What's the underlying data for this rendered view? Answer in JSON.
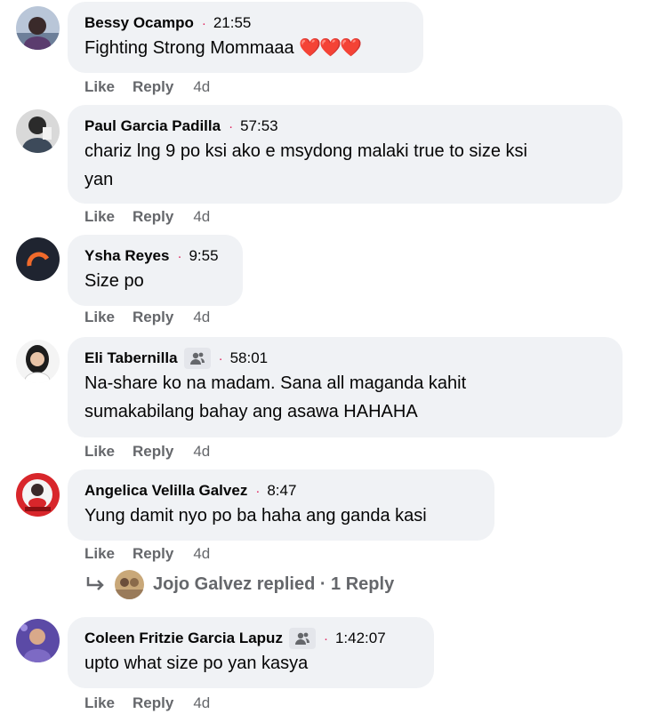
{
  "comments": [
    {
      "author": "Bessy Ocampo",
      "time": "21:55",
      "text": "Fighting Strong Mommaaa",
      "emoji": "❤️❤️❤️",
      "like": "Like",
      "reply": "Reply",
      "age": "4d"
    },
    {
      "author": "Paul Garcia Padilla",
      "time": "57:53",
      "text_line1": "chariz lng 9 po ksi ako e msydong malaki true to size ksi",
      "text_line2": "yan",
      "like": "Like",
      "reply": "Reply",
      "age": "4d"
    },
    {
      "author": "Ysha Reyes",
      "time": "9:55",
      "text": "Size po",
      "like": "Like",
      "reply": "Reply",
      "age": "4d"
    },
    {
      "author": "Eli Tabernilla",
      "time": "58:01",
      "text_line1": "Na-share ko na madam. Sana all maganda kahit",
      "text_line2": "sumakabilang bahay ang asawa HAHAHA",
      "like": "Like",
      "reply": "Reply",
      "age": "4d"
    },
    {
      "author": "Angelica Velilla Galvez",
      "time": "8:47",
      "text": "Yung damit nyo po ba haha ang ganda kasi",
      "like": "Like",
      "reply": "Reply",
      "age": "4d",
      "replies_summary": "Jojo Galvez replied · 1 Reply"
    },
    {
      "author": "Coleen Fritzie Garcia Lapuz",
      "time": "1:42:07",
      "text": "upto what size po yan kasya",
      "like": "Like",
      "reply": "Reply",
      "age": "4d"
    }
  ],
  "icons": {
    "fan_badge": "people-badge-icon",
    "reply_arrow": "reply-arrow-icon"
  }
}
